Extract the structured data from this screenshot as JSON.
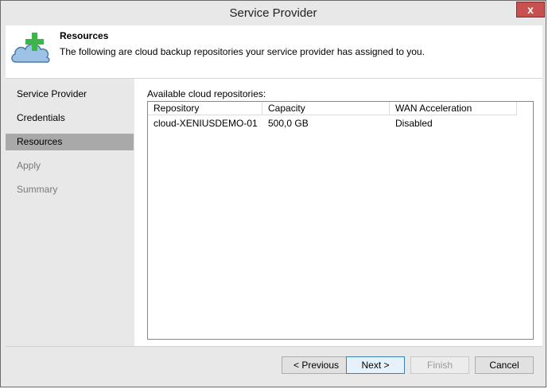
{
  "window": {
    "title": "Service Provider",
    "close_glyph": "x"
  },
  "header": {
    "icon": "cloud-add-icon",
    "title": "Resources",
    "description": "The following are cloud backup repositories your service provider has assigned to you."
  },
  "sidebar": {
    "items": [
      {
        "label": "Service Provider",
        "state": "normal"
      },
      {
        "label": "Credentials",
        "state": "normal"
      },
      {
        "label": "Resources",
        "state": "active"
      },
      {
        "label": "Apply",
        "state": "disabled"
      },
      {
        "label": "Summary",
        "state": "disabled"
      }
    ]
  },
  "main": {
    "label": "Available cloud repositories:",
    "columns": [
      "Repository",
      "Capacity",
      "WAN Acceleration"
    ],
    "rows": [
      [
        "cloud-XENIUSDEMO-01",
        "500,0 GB",
        "Disabled"
      ]
    ]
  },
  "buttons": {
    "previous": "< Previous",
    "next": "Next >",
    "finish": "Finish",
    "cancel": "Cancel"
  },
  "colors": {
    "active_nav": "#a9a9a9",
    "close_button": "#c75050",
    "plus_icon": "#3cb54a",
    "cloud_icon": "#9cc3e6"
  }
}
